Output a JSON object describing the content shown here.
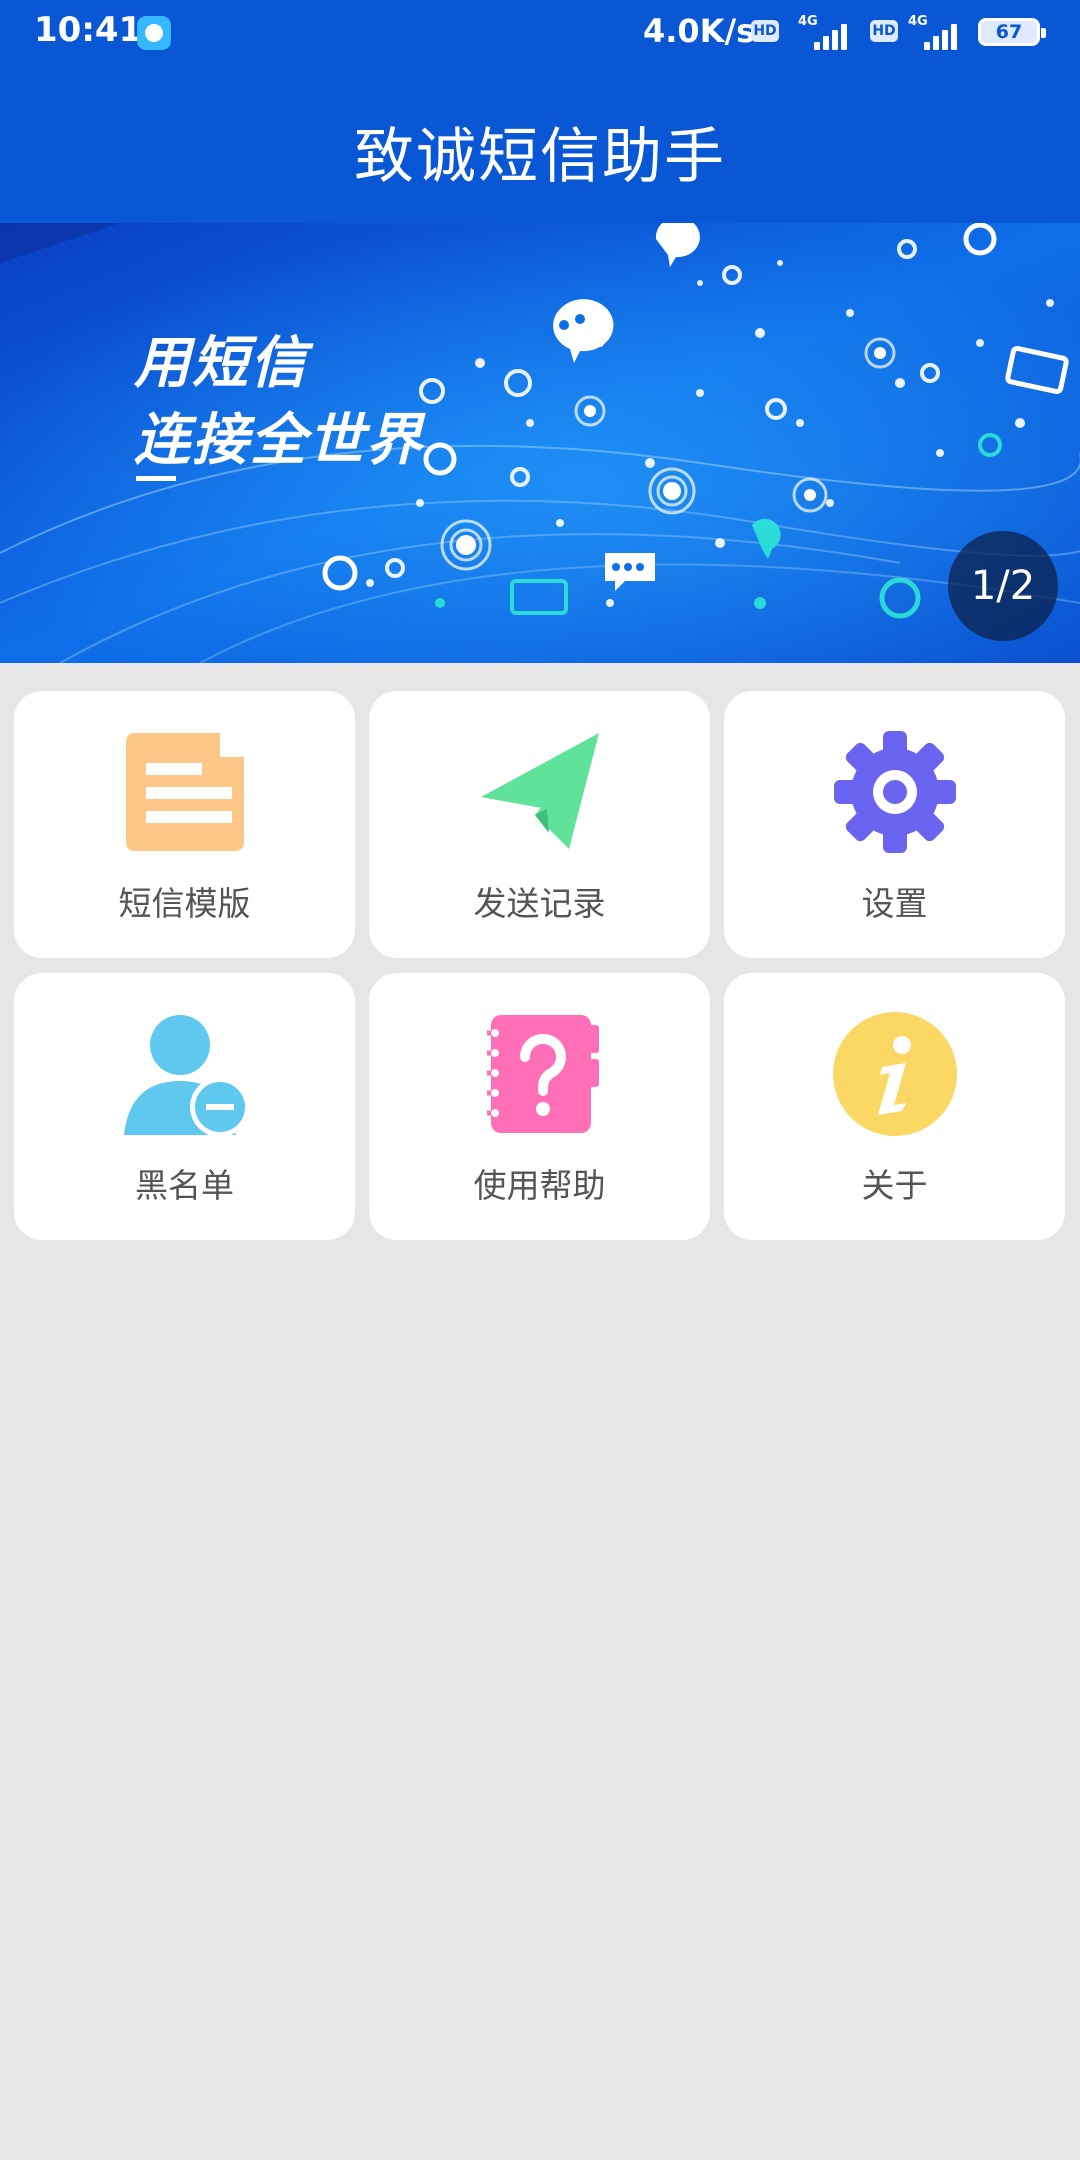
{
  "status_bar": {
    "time": "10:41",
    "net_speed": "4.0K/s",
    "hd_badge": "HD",
    "network_1": "4G",
    "network_2": "4G",
    "battery": "67"
  },
  "header": {
    "title": "致诚短信助手"
  },
  "banner": {
    "line1": "用短信",
    "line2": "连接全世界",
    "indicator": "1/2"
  },
  "menu": [
    {
      "label": "短信模版",
      "icon": "document-icon",
      "color": "#fdc887"
    },
    {
      "label": "发送记录",
      "icon": "paper-plane-icon",
      "color": "#5fe29a"
    },
    {
      "label": "设置",
      "icon": "gear-icon",
      "color": "#6a64f0"
    },
    {
      "label": "黑名单",
      "icon": "user-remove-icon",
      "color": "#5ec8ef"
    },
    {
      "label": "使用帮助",
      "icon": "help-notebook-icon",
      "color": "#ff6fb8"
    },
    {
      "label": "关于",
      "icon": "info-icon",
      "color": "#fbd863"
    }
  ],
  "colors": {
    "header_bg": "#0a57d6",
    "page_bg": "#e6e6e6",
    "label_text": "#555555"
  }
}
